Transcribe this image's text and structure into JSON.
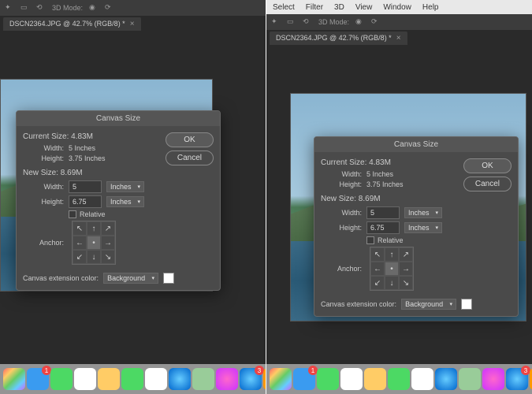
{
  "menubar": {
    "items": [
      "Select",
      "Filter",
      "3D",
      "View",
      "Window",
      "Help"
    ]
  },
  "tab": {
    "label": "DSCN2364.JPG @ 42.7% (RGB/8) *"
  },
  "dialog": {
    "title": "Canvas Size",
    "ok": "OK",
    "cancel": "Cancel",
    "current": {
      "title": "Current Size: 4.83M",
      "width_lbl": "Width:",
      "width_val": "5 Inches",
      "height_lbl": "Height:",
      "height_val": "3.75 Inches"
    },
    "new": {
      "title": "New Size: 8.69M",
      "width_lbl": "Width:",
      "width_val": "5",
      "height_lbl": "Height:",
      "height_val": "6.75",
      "unit": "Inches"
    },
    "relative": "Relative",
    "anchor_lbl": "Anchor:",
    "ext_lbl": "Canvas extension color:",
    "ext_val": "Background"
  },
  "dock": {
    "icons": [
      {
        "name": "photos-icon",
        "bg": "linear-gradient(135deg,#f66,#fc6,#6c6,#6cf,#c6f)"
      },
      {
        "name": "mail-icon",
        "bg": "#3a9bf0",
        "badge": "1"
      },
      {
        "name": "messages-icon",
        "bg": "#4cd964",
        "badge": ""
      },
      {
        "name": "calendar-icon",
        "bg": "#fff"
      },
      {
        "name": "notes-icon",
        "bg": "#fc6"
      },
      {
        "name": "numbers-icon",
        "bg": "#4cd964"
      },
      {
        "name": "reminders-icon",
        "bg": "#fff"
      },
      {
        "name": "safari-icon",
        "bg": "radial-gradient(#6cf,#06c)"
      },
      {
        "name": "maps-icon",
        "bg": "#9c9"
      },
      {
        "name": "itunes-icon",
        "bg": "radial-gradient(#f6c,#c3f)"
      },
      {
        "name": "appstore-icon",
        "bg": "radial-gradient(#6cf,#06c)",
        "badge": "3"
      },
      {
        "name": "ibooks-icon",
        "bg": "#f90"
      },
      {
        "name": "preferences-icon",
        "bg": "#888"
      }
    ]
  }
}
